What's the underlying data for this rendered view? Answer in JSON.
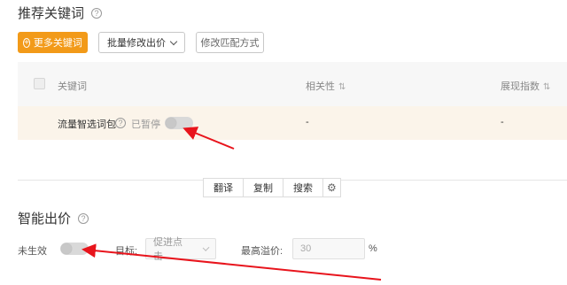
{
  "recommend": {
    "title": "推荐关键词",
    "help_glyph": "?",
    "more_keywords_button": "更多关键词",
    "plus_glyph": "+",
    "batch_bid_select": "批量修改出价",
    "match_mode_button": "修改匹配方式",
    "table": {
      "col_keyword": "关键词",
      "col_relevance": "相关性",
      "col_exposure": "展现指数",
      "sort_glyph": "⇅",
      "row": {
        "keyword": "流量智选词包",
        "status": "已暂停",
        "relevance": "-",
        "exposure": "-"
      }
    }
  },
  "tools": {
    "translate": "翻译",
    "copy": "复制",
    "search": "搜索",
    "gear_glyph": "⚙"
  },
  "smart_bid": {
    "title": "智能出价",
    "status": "未生效",
    "goal_label": "目标:",
    "goal_value": "促进点击",
    "max_premium_label": "最高溢价:",
    "max_premium_value": "30",
    "percent": "%"
  },
  "colors": {
    "accent": "#f29a19",
    "annotation_arrow": "#e8141c"
  }
}
